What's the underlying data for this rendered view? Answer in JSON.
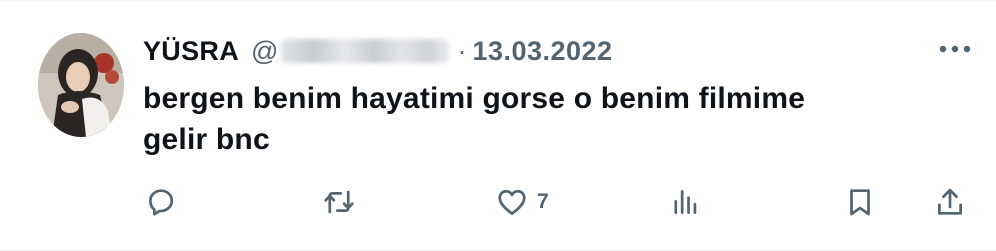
{
  "tweet": {
    "display_name": "YÜSRA",
    "handle_prefix": "@",
    "separator": "·",
    "date": "13.03.2022",
    "text_line1": "bergen benim hayatimi gorse o benim filmime",
    "text_line2": "gelir bnc"
  },
  "actions": {
    "likes_count": "7"
  },
  "icons": {
    "reply": "reply-icon",
    "retweet": "retweet-icon",
    "like": "heart-icon",
    "views": "views-icon",
    "bookmark": "bookmark-icon",
    "share": "share-icon",
    "more": "more-icon"
  },
  "colors": {
    "text_primary": "#0f1419",
    "text_secondary": "#536471",
    "background": "#ffffff"
  }
}
